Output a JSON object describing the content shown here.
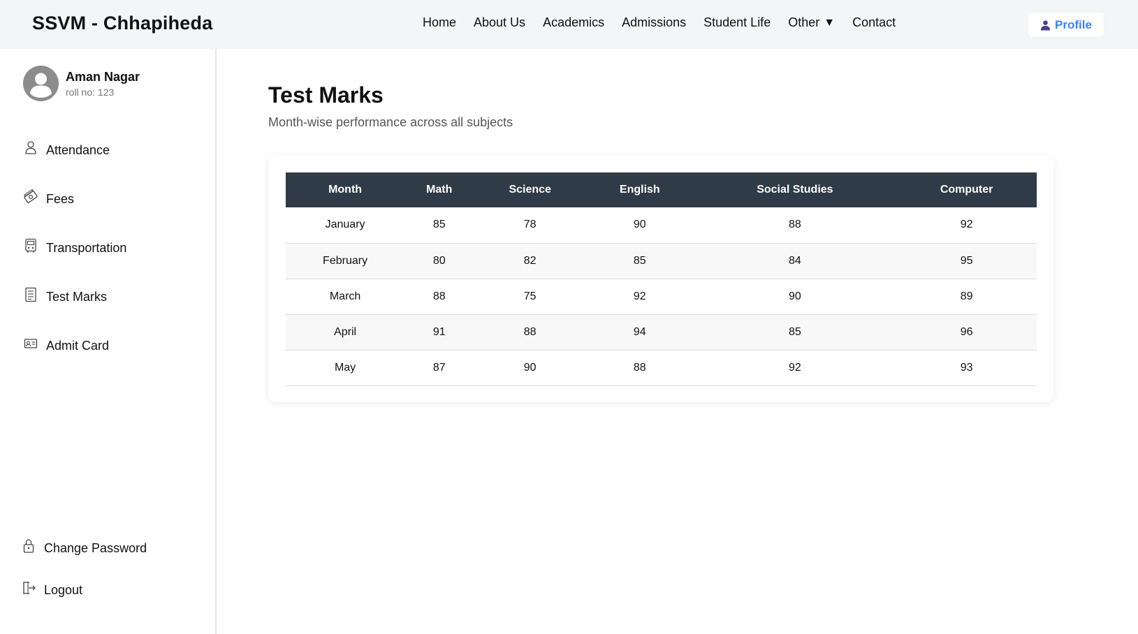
{
  "header": {
    "brand": "SSVM - Chhapiheda",
    "nav": [
      "Home",
      "About Us",
      "Academics",
      "Admissions",
      "Student Life",
      "Other",
      "Contact"
    ],
    "profile_label": "Profile",
    "accent_color": "#3b82f6"
  },
  "sidebar": {
    "user": {
      "name": "Aman Nagar",
      "roll": "roll no: 123"
    },
    "items": [
      {
        "label": "Attendance",
        "icon": "person-icon"
      },
      {
        "label": "Fees",
        "icon": "money-icon"
      },
      {
        "label": "Transportation",
        "icon": "bus-icon"
      },
      {
        "label": "Test Marks",
        "icon": "document-icon"
      },
      {
        "label": "Admit Card",
        "icon": "id-card-icon"
      }
    ],
    "bottom_items": [
      {
        "label": "Change Password",
        "icon": "lock-icon"
      },
      {
        "label": "Logout",
        "icon": "logout-icon"
      }
    ]
  },
  "main": {
    "title": "Test Marks",
    "subtitle": "Month-wise performance across all subjects",
    "table": {
      "headers": [
        "Month",
        "Math",
        "Science",
        "English",
        "Social Studies",
        "Computer"
      ],
      "rows": [
        [
          "January",
          "85",
          "78",
          "90",
          "88",
          "92"
        ],
        [
          "February",
          "80",
          "82",
          "85",
          "84",
          "95"
        ],
        [
          "March",
          "88",
          "75",
          "92",
          "90",
          "89"
        ],
        [
          "April",
          "91",
          "88",
          "94",
          "85",
          "96"
        ],
        [
          "May",
          "87",
          "90",
          "88",
          "92",
          "93"
        ]
      ],
      "header_bg": "#2f3b46"
    }
  }
}
